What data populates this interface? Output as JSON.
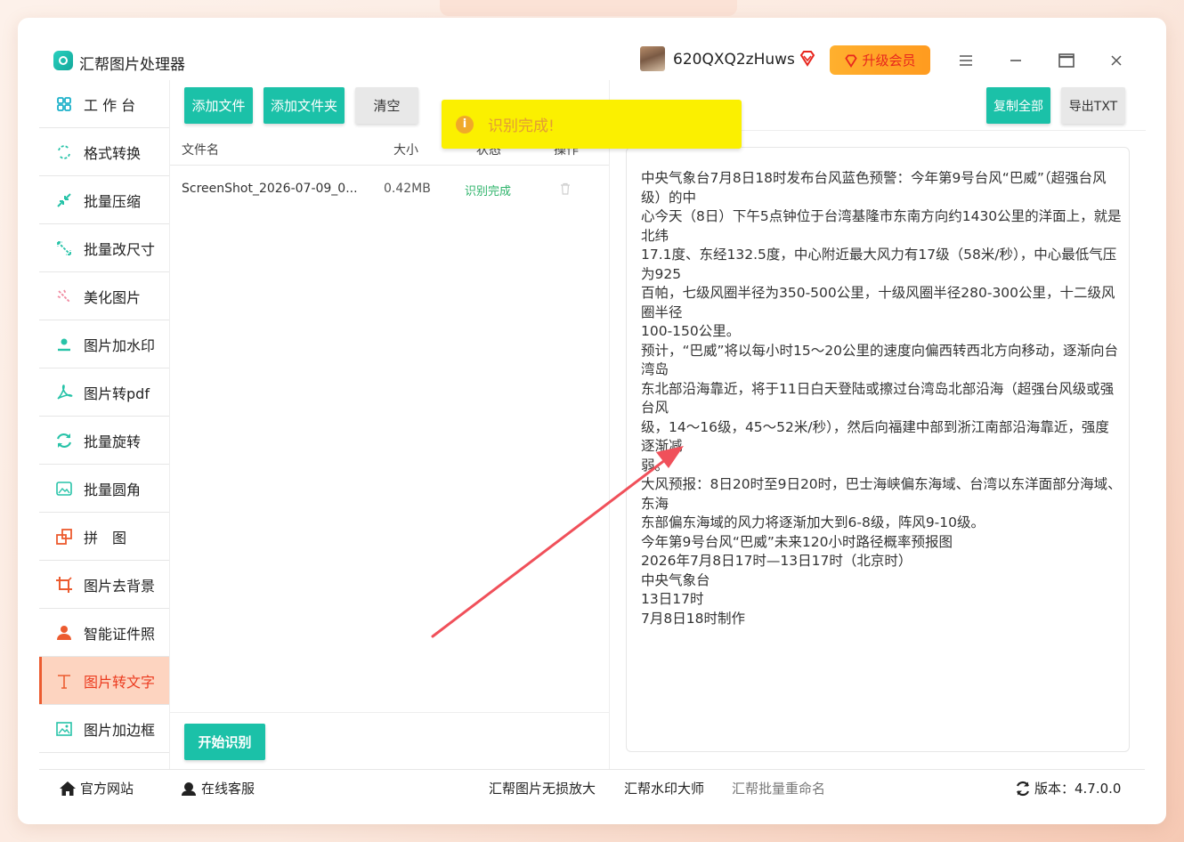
{
  "app": {
    "title": "汇帮图片处理器"
  },
  "user": {
    "name": "620QXQ2zHuws",
    "upgrade_label": "升级会员"
  },
  "sidebar": {
    "items": [
      {
        "label": "工 作 台",
        "icon": "grid-icon",
        "color": "#1bb0c9"
      },
      {
        "label": "格式转换",
        "icon": "convert-icon",
        "color": "#27c3a8"
      },
      {
        "label": "批量压缩",
        "icon": "compress-icon",
        "color": "#27c3a8"
      },
      {
        "label": "批量改尺寸",
        "icon": "resize-icon",
        "color": "#27c3a8"
      },
      {
        "label": "美化图片",
        "icon": "beautify-icon",
        "color": "#f08aa0"
      },
      {
        "label": "图片加水印",
        "icon": "watermark-icon",
        "color": "#27c3a8"
      },
      {
        "label": "图片转pdf",
        "icon": "pdf-icon",
        "color": "#27c3a8"
      },
      {
        "label": "批量旋转",
        "icon": "rotate-icon",
        "color": "#27c3a8"
      },
      {
        "label": "批量圆角",
        "icon": "round-corner-icon",
        "color": "#27c3a8"
      },
      {
        "label": "拼　图",
        "icon": "puzzle-icon",
        "color": "#ec5b2f"
      },
      {
        "label": "图片去背景",
        "icon": "crop-icon",
        "color": "#ec5b2f"
      },
      {
        "label": "智能证件照",
        "icon": "person-icon",
        "color": "#ec5b2f"
      },
      {
        "label": "图片转文字",
        "icon": "text-icon",
        "color": "#ec5b2f",
        "active": true
      },
      {
        "label": "图片加边框",
        "icon": "frame-icon",
        "color": "#27c3a8"
      }
    ]
  },
  "toolbar": {
    "add_file": "添加文件",
    "add_folder": "添加文件夹",
    "clear": "清空",
    "start": "开始识别",
    "copy_all": "复制全部",
    "export_txt": "导出TXT"
  },
  "table": {
    "headers": {
      "name": "文件名",
      "size": "大小",
      "status": "状态",
      "action": "操作"
    },
    "rows": [
      {
        "name": "ScreenShot_2026-07-09_0...",
        "size": "0.42MB",
        "status": "识别完成"
      }
    ]
  },
  "toast": {
    "text": "识别完成!"
  },
  "ocr_text": "中央气象台7月8日18时发布台风蓝色预警：今年第9号台风“巴威”（超强台风级）的中\n心今天（8日）下午5点钟位于台湾基隆市东南方向约1430公里的洋面上，就是北纬\n17.1度、东经132.5度，中心附近最大风力有17级（58米/秒），中心最低气压为925\n百帕，七级风圈半径为350-500公里，十级风圈半径280-300公里，十二级风圈半径\n100-150公里。\n预计，“巴威”将以每小时15～20公里的速度向偏西转西北方向移动，逐渐向台湾岛\n东北部沿海靠近，将于11日白天登陆或擦过台湾岛北部沿海（超强台风级或强台风\n级，14～16级，45～52米/秒），然后向福建中部到浙江南部沿海靠近，强度逐渐减\n弱。\n大风预报：8日20时至9日20时，巴士海峡偏东海域、台湾以东洋面部分海域、东海\n东部偏东海域的风力将逐渐加大到6-8级，阵风9-10级。\n今年第9号台风“巴威”未来120小时路径概率预报图\n2026年7月8日17时—13日17时（北京时）\n中央气象台\n13日17时\n7月8日18时制作",
  "footer": {
    "website": "官方网站",
    "support": "在线客服",
    "link1": "汇帮图片无损放大",
    "link2": "汇帮水印大师",
    "link3": "汇帮批量重命名",
    "version": "版本：4.7.0.0"
  },
  "colors": {
    "accent": "#1bc1a8",
    "active_bg": "#fdd4c0",
    "active_text": "#ec3b1f",
    "toast_bg": "#fbf000",
    "arrow": "#f0505a"
  }
}
